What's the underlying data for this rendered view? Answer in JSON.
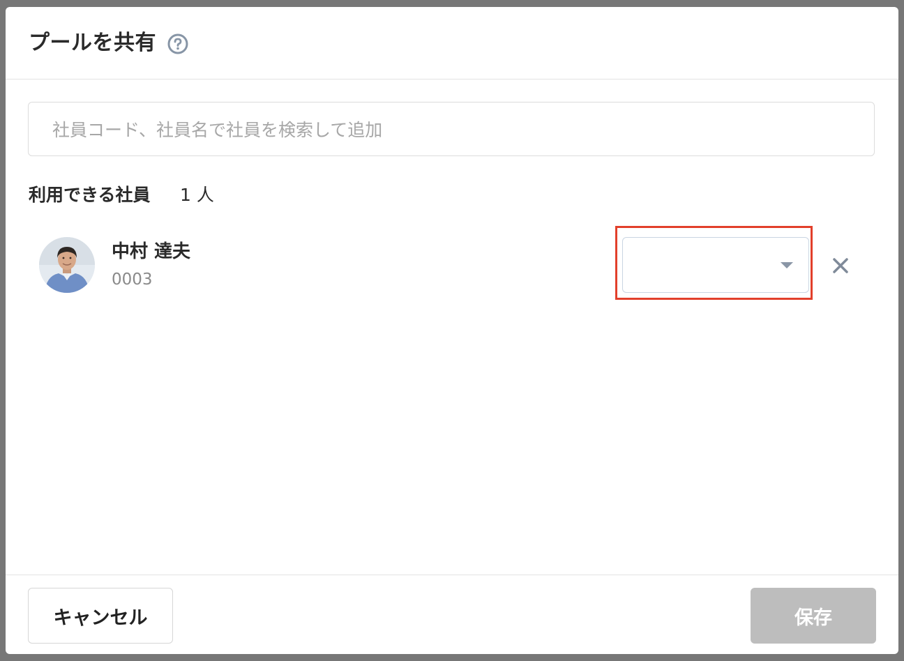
{
  "dialog": {
    "title": "プールを共有",
    "help_icon": "question-circle-icon"
  },
  "search": {
    "placeholder": "社員コード、社員名で社員を検索して追加",
    "value": ""
  },
  "members_section": {
    "label": "利用できる社員",
    "count": "1 人"
  },
  "members": [
    {
      "name": "中村 達夫",
      "code": "0003",
      "role_value": "",
      "remove_icon": "close-icon"
    }
  ],
  "footer": {
    "cancel_label": "キャンセル",
    "save_label": "保存",
    "save_disabled": true
  },
  "colors": {
    "highlight": "#e2402b",
    "save_disabled_bg": "#bdbdbd",
    "select_border": "#c9d5e2"
  }
}
